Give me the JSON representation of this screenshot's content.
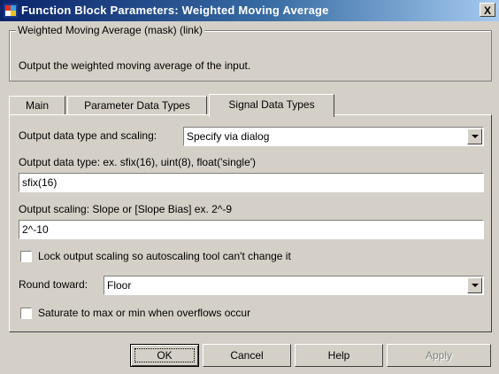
{
  "window": {
    "title": "Function Block Parameters: Weighted Moving Average",
    "close_glyph": "X"
  },
  "mask": {
    "group_title": "Weighted Moving Average (mask) (link)",
    "description": "Output the weighted moving average of the input."
  },
  "tabs": [
    "Main",
    "Parameter Data Types",
    "Signal Data Types"
  ],
  "active_tab": "Signal Data Types",
  "form": {
    "output_mode_label": "Output data type and scaling:",
    "output_mode_value": "Specify via dialog",
    "output_type_label": "Output data type:   ex.  sfix(16),  uint(8),  float('single')",
    "output_type_value": "sfix(16)",
    "output_scaling_label": "Output scaling:   Slope or [Slope Bias]   ex.  2^-9",
    "output_scaling_value": "2^-10",
    "lock_scaling_label": "Lock output scaling so autoscaling tool can't change it",
    "lock_scaling_checked": false,
    "round_label": "Round toward:",
    "round_value": "Floor",
    "saturate_label": "Saturate to max or min when overflows occur",
    "saturate_checked": false
  },
  "buttons": {
    "ok": "OK",
    "cancel": "Cancel",
    "help": "Help",
    "apply": "Apply"
  },
  "colors": {
    "title_start": "#0a246a",
    "title_end": "#a6caf0",
    "face": "#d4d0c8"
  }
}
